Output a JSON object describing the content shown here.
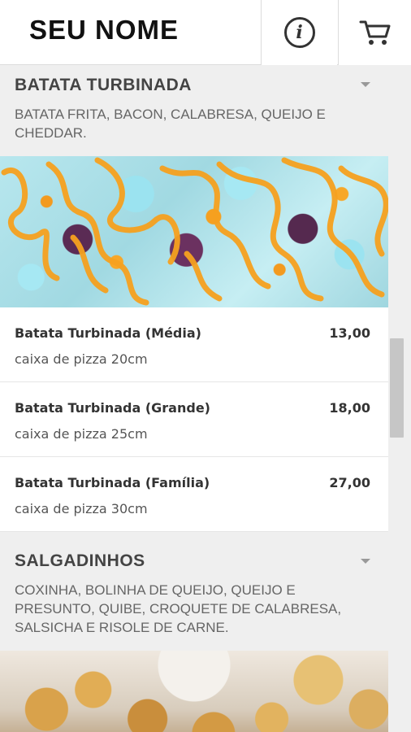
{
  "header": {
    "brand": "SEU NOME",
    "info_icon": "info-icon",
    "cart_icon": "cart-icon"
  },
  "categories": [
    {
      "title": "BATATA TURBINADA",
      "description": "BATATA FRITA, BACON, CALABRESA, QUEIJO E CHEDDAR.",
      "items": [
        {
          "name": "Batata Turbinada (Média)",
          "price": "13,00",
          "desc": "caixa de pizza 20cm"
        },
        {
          "name": "Batata Turbinada (Grande)",
          "price": "18,00",
          "desc": "caixa de pizza 25cm"
        },
        {
          "name": "Batata Turbinada (Família)",
          "price": "27,00",
          "desc": "caixa de pizza 30cm"
        }
      ]
    },
    {
      "title": "SALGADINHOS",
      "description": "COXINHA, BOLINHA DE QUEIJO, QUEIJO E PRESUNTO, QUIBE, CROQUETE DE CALABRESA, SALSICHA E RISOLE DE CARNE."
    }
  ],
  "colors": {
    "background": "#efefef",
    "header": "#ffffff",
    "text": "#333333"
  }
}
